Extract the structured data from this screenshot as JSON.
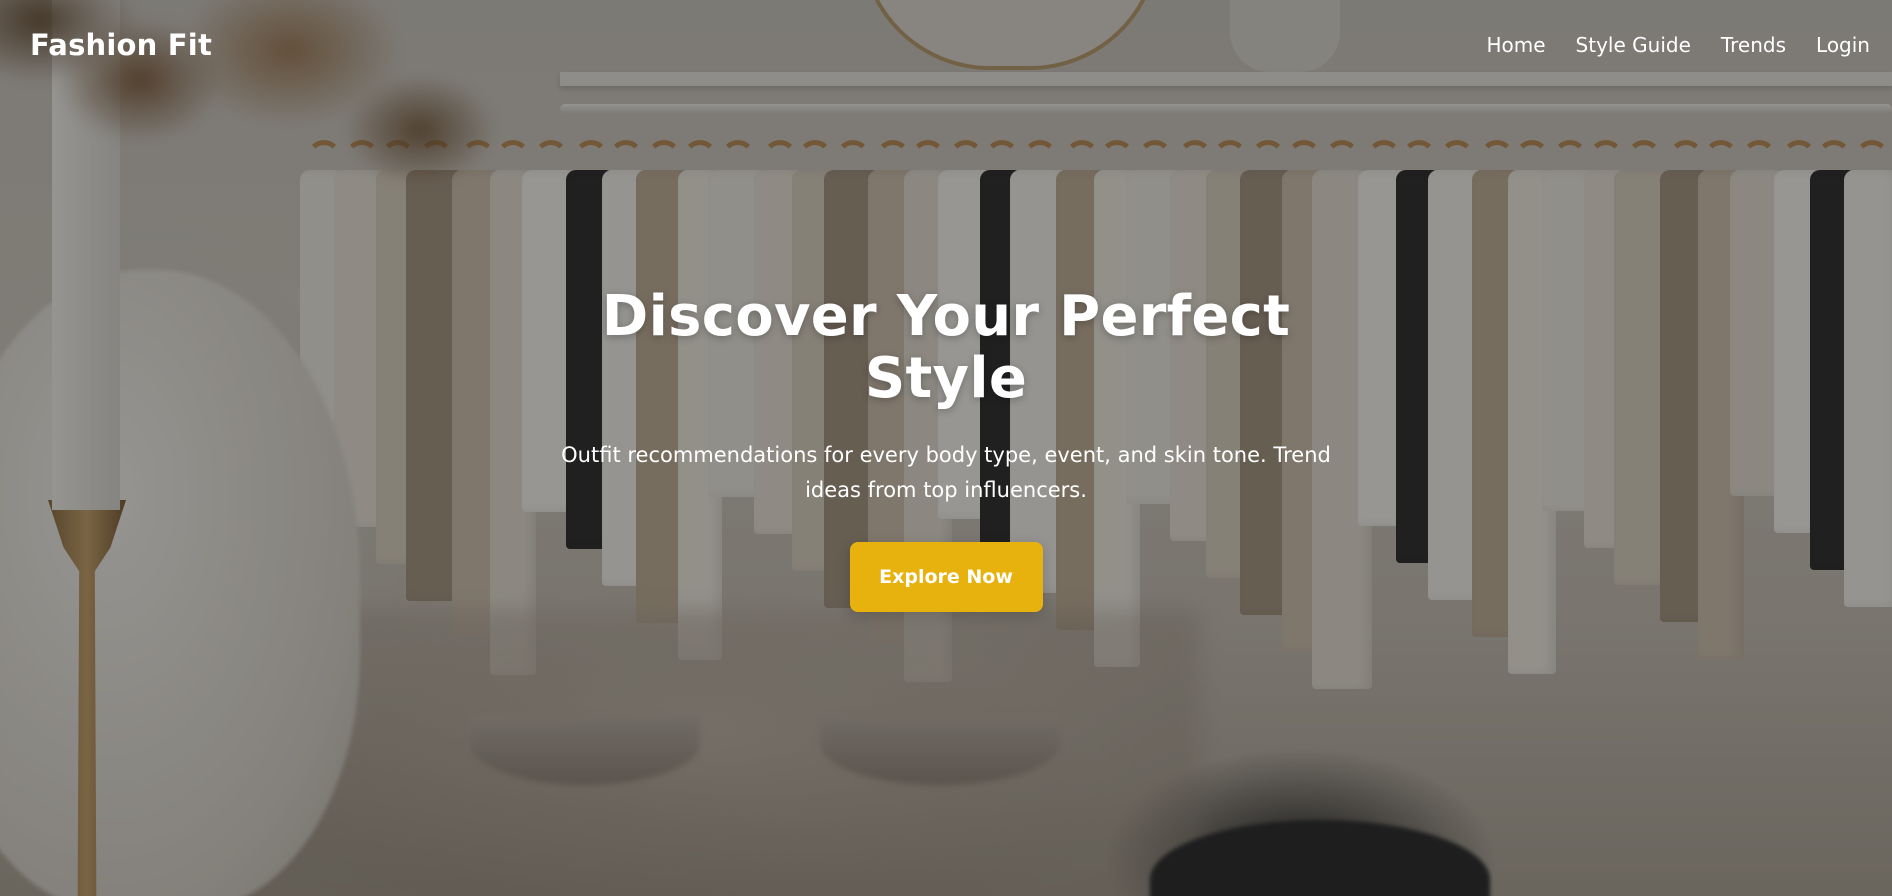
{
  "brand": {
    "name": "Fashion Fit"
  },
  "nav": {
    "items": [
      {
        "label": "Home"
      },
      {
        "label": "Style Guide"
      },
      {
        "label": "Trends"
      },
      {
        "label": "Login"
      }
    ]
  },
  "hero": {
    "title": "Discover Your Perfect Style",
    "subtitle": "Outfit recommendations for every body type, event, and skin tone. Trend ideas from top influencers.",
    "cta_label": "Explore Now",
    "background_description": "clothing-rack-boutique-photo"
  },
  "colors": {
    "accent": "#e8b20e",
    "text": "#ffffff",
    "overlay": "#141210"
  }
}
